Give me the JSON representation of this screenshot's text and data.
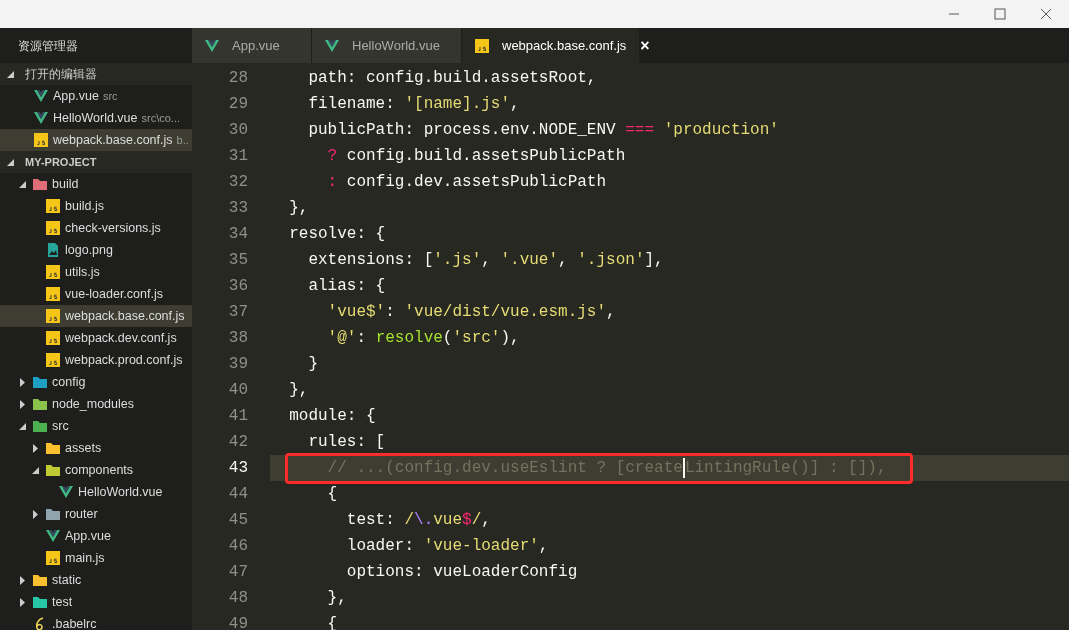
{
  "sidebar": {
    "title": "资源管理器",
    "sections": [
      {
        "label": "打开的编辑器",
        "expanded": true,
        "kind": "open-editors",
        "items": [
          {
            "name": "App.vue",
            "kind": "vue",
            "hint": "src",
            "selected": false
          },
          {
            "name": "HelloWorld.vue",
            "kind": "vue",
            "hint": "src\\co...",
            "selected": false
          },
          {
            "name": "webpack.base.conf.js",
            "kind": "js",
            "hint": "b..",
            "selected": true
          }
        ]
      },
      {
        "label": "MY-PROJECT",
        "expanded": true,
        "kind": "tree",
        "items": [
          {
            "name": "build",
            "kind": "folder",
            "color": "#e06c75",
            "expanded": true,
            "selected": false,
            "children": [
              {
                "name": "build.js",
                "kind": "js",
                "selected": false
              },
              {
                "name": "check-versions.js",
                "kind": "js",
                "selected": false
              },
              {
                "name": "logo.png",
                "kind": "image",
                "selected": false
              },
              {
                "name": "utils.js",
                "kind": "js",
                "selected": false
              },
              {
                "name": "vue-loader.conf.js",
                "kind": "js",
                "selected": false
              },
              {
                "name": "webpack.base.conf.js",
                "kind": "js",
                "selected": true
              },
              {
                "name": "webpack.dev.conf.js",
                "kind": "js",
                "selected": false
              },
              {
                "name": "webpack.prod.conf.js",
                "kind": "js",
                "selected": false
              }
            ]
          },
          {
            "name": "config",
            "kind": "folder",
            "color": "#1e9fc4",
            "expanded": false,
            "selected": false
          },
          {
            "name": "node_modules",
            "kind": "folder",
            "color": "#8bc34a",
            "expanded": false,
            "selected": false
          },
          {
            "name": "src",
            "kind": "folder",
            "color": "#4caf50",
            "expanded": true,
            "selected": false,
            "children": [
              {
                "name": "assets",
                "kind": "folder",
                "color": "#fbc02d",
                "expanded": false,
                "selected": false
              },
              {
                "name": "components",
                "kind": "folder",
                "color": "#c0ca33",
                "expanded": true,
                "selected": false,
                "children": [
                  {
                    "name": "HelloWorld.vue",
                    "kind": "vue",
                    "selected": false
                  }
                ]
              },
              {
                "name": "router",
                "kind": "folder",
                "color": "#90a4ae",
                "expanded": false,
                "selected": false
              },
              {
                "name": "App.vue",
                "kind": "vue",
                "selected": false
              },
              {
                "name": "main.js",
                "kind": "js",
                "selected": false
              }
            ]
          },
          {
            "name": "static",
            "kind": "folder",
            "color": "#fbc02d",
            "expanded": false,
            "selected": false
          },
          {
            "name": "test",
            "kind": "folder",
            "color": "#26c6a6",
            "expanded": false,
            "selected": false
          },
          {
            "name": ".babelrc",
            "kind": "babel",
            "selected": false
          }
        ]
      }
    ]
  },
  "tabs": [
    {
      "label": "App.vue",
      "kind": "vue",
      "selected": false
    },
    {
      "label": "HelloWorld.vue",
      "kind": "vue",
      "selected": false
    },
    {
      "label": "webpack.base.conf.js",
      "kind": "js",
      "selected": true,
      "close": "×"
    }
  ],
  "editor": {
    "lines": [
      {
        "number": "28",
        "current": false,
        "annotated": false,
        "tokens": [
          {
            "kind": "plain",
            "text": "    path: config.build.assetsRoot,"
          }
        ]
      },
      {
        "number": "29",
        "current": false,
        "annotated": false,
        "tokens": [
          {
            "kind": "plain",
            "text": "    filename: "
          },
          {
            "kind": "string",
            "text": "'[name].js'"
          },
          {
            "kind": "plain",
            "text": ","
          }
        ]
      },
      {
        "number": "30",
        "current": false,
        "annotated": false,
        "tokens": [
          {
            "kind": "plain",
            "text": "    publicPath: process.env.NODE_ENV "
          },
          {
            "kind": "operator",
            "text": "==="
          },
          {
            "kind": "string",
            "text": " 'production'"
          }
        ]
      },
      {
        "number": "31",
        "current": false,
        "annotated": false,
        "tokens": [
          {
            "kind": "operator",
            "text": "      ?"
          },
          {
            "kind": "plain",
            "text": " config.build.assetsPublicPath"
          }
        ]
      },
      {
        "number": "32",
        "current": false,
        "annotated": false,
        "tokens": [
          {
            "kind": "operator",
            "text": "      :"
          },
          {
            "kind": "plain",
            "text": " config.dev.assetsPublicPath"
          }
        ]
      },
      {
        "number": "33",
        "current": false,
        "annotated": false,
        "tokens": [
          {
            "kind": "plain",
            "text": "  },"
          }
        ]
      },
      {
        "number": "34",
        "current": false,
        "annotated": false,
        "tokens": [
          {
            "kind": "plain",
            "text": "  resolve: {"
          }
        ]
      },
      {
        "number": "35",
        "current": false,
        "annotated": false,
        "tokens": [
          {
            "kind": "plain",
            "text": "    extensions: ["
          },
          {
            "kind": "string",
            "text": "'.js'"
          },
          {
            "kind": "plain",
            "text": ", "
          },
          {
            "kind": "string",
            "text": "'.vue'"
          },
          {
            "kind": "plain",
            "text": ", "
          },
          {
            "kind": "string",
            "text": "'.json'"
          },
          {
            "kind": "plain",
            "text": "],"
          }
        ]
      },
      {
        "number": "36",
        "current": false,
        "annotated": false,
        "tokens": [
          {
            "kind": "plain",
            "text": "    alias: {"
          }
        ]
      },
      {
        "number": "37",
        "current": false,
        "annotated": false,
        "tokens": [
          {
            "kind": "string",
            "text": "      'vue$'"
          },
          {
            "kind": "plain",
            "text": ": "
          },
          {
            "kind": "string",
            "text": "'vue/dist/vue.esm.js'"
          },
          {
            "kind": "plain",
            "text": ","
          }
        ]
      },
      {
        "number": "38",
        "current": false,
        "annotated": false,
        "tokens": [
          {
            "kind": "string",
            "text": "      '@'"
          },
          {
            "kind": "plain",
            "text": ": "
          },
          {
            "kind": "function",
            "text": "resolve"
          },
          {
            "kind": "plain",
            "text": "("
          },
          {
            "kind": "string",
            "text": "'src'"
          },
          {
            "kind": "plain",
            "text": "),"
          }
        ]
      },
      {
        "number": "39",
        "current": false,
        "annotated": false,
        "tokens": [
          {
            "kind": "plain",
            "text": "    }"
          }
        ]
      },
      {
        "number": "40",
        "current": false,
        "annotated": false,
        "tokens": [
          {
            "kind": "plain",
            "text": "  },"
          }
        ]
      },
      {
        "number": "41",
        "current": false,
        "annotated": false,
        "tokens": [
          {
            "kind": "plain",
            "text": "  module: {"
          }
        ]
      },
      {
        "number": "42",
        "current": false,
        "annotated": false,
        "tokens": [
          {
            "kind": "plain",
            "text": "    rules: ["
          }
        ]
      },
      {
        "number": "43",
        "current": true,
        "annotated": true,
        "tokens": [
          {
            "kind": "comment",
            "text": "      // ...(config.dev.useEslint ? [create"
          },
          {
            "kind": "cursor"
          },
          {
            "kind": "comment",
            "text": "LintingRule()] : []),"
          }
        ]
      },
      {
        "number": "44",
        "current": false,
        "annotated": false,
        "tokens": [
          {
            "kind": "plain",
            "text": "      {"
          }
        ]
      },
      {
        "number": "45",
        "current": false,
        "annotated": false,
        "tokens": [
          {
            "kind": "plain",
            "text": "        test: "
          },
          {
            "kind": "string",
            "text": "/"
          },
          {
            "kind": "regex",
            "text": "\\."
          },
          {
            "kind": "string",
            "text": "vue"
          },
          {
            "kind": "operator",
            "text": "$"
          },
          {
            "kind": "string",
            "text": "/"
          },
          {
            "kind": "plain",
            "text": ","
          }
        ]
      },
      {
        "number": "46",
        "current": false,
        "annotated": false,
        "tokens": [
          {
            "kind": "plain",
            "text": "        loader: "
          },
          {
            "kind": "string",
            "text": "'vue-loader'"
          },
          {
            "kind": "plain",
            "text": ","
          }
        ]
      },
      {
        "number": "47",
        "current": false,
        "annotated": false,
        "tokens": [
          {
            "kind": "plain",
            "text": "        options: vueLoaderConfig"
          }
        ]
      },
      {
        "number": "48",
        "current": false,
        "annotated": false,
        "tokens": [
          {
            "kind": "plain",
            "text": "      },"
          }
        ]
      },
      {
        "number": "49",
        "current": false,
        "annotated": false,
        "tokens": [
          {
            "kind": "plain",
            "text": "      {"
          }
        ]
      }
    ]
  }
}
